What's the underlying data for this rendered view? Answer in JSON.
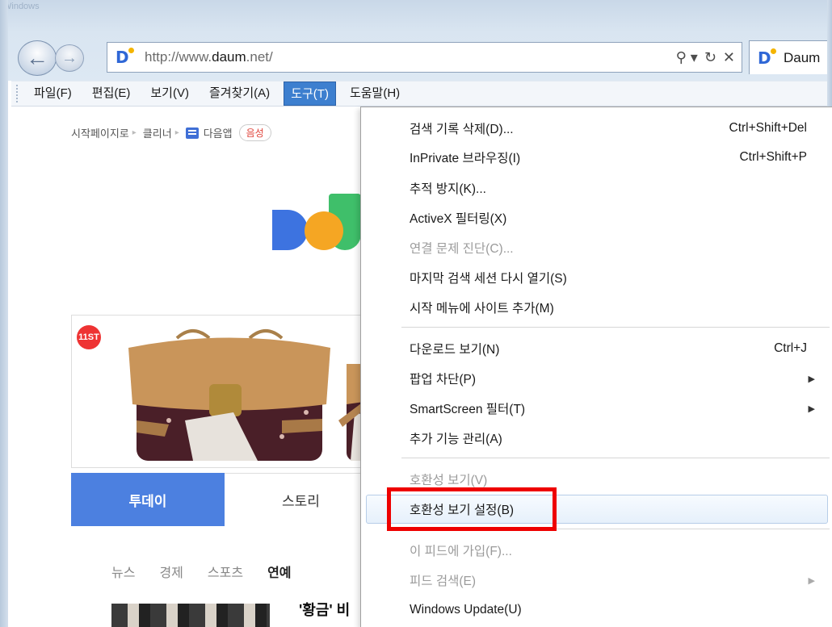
{
  "window": {
    "title_fragment": "Windows Internet Explorer"
  },
  "navigation": {
    "back_label": "←",
    "forward_label": "→"
  },
  "address_bar": {
    "url_prefix": "http://www.",
    "url_domain": "daum",
    "url_suffix": ".net/",
    "search_icon": "⚲ ▾",
    "refresh_icon": "↻",
    "stop_icon": "✕"
  },
  "tab": {
    "title": "Daum"
  },
  "menubar": {
    "items": [
      {
        "label": "파일(F)"
      },
      {
        "label": "편집(E)"
      },
      {
        "label": "보기(V)"
      },
      {
        "label": "즐겨찾기(A)"
      },
      {
        "label": "도구(T)",
        "active": true
      },
      {
        "label": "도움말(H)"
      }
    ]
  },
  "page": {
    "startbar": {
      "start_page": "시작페이지로",
      "cleaner": "클리너",
      "app": "다음앱",
      "pill": "음성"
    },
    "ad_badge": "11ST",
    "tabs": [
      {
        "label": "투데이",
        "active": true
      },
      {
        "label": "스토리",
        "active": false
      }
    ],
    "subnav": [
      "뉴스",
      "경제",
      "스포츠",
      "연예"
    ],
    "news_title": "'황금' 비"
  },
  "tools_menu": {
    "items": [
      {
        "label": "검색 기록 삭제(D)...",
        "shortcut": "Ctrl+Shift+Del",
        "enabled": true
      },
      {
        "label": "InPrivate 브라우징(I)",
        "shortcut": "Ctrl+Shift+P",
        "enabled": true
      },
      {
        "label": "추적 방지(K)...",
        "shortcut": "",
        "enabled": true
      },
      {
        "label": "ActiveX 필터링(X)",
        "shortcut": "",
        "enabled": true
      },
      {
        "label": "연결 문제 진단(C)...",
        "shortcut": "",
        "enabled": false
      },
      {
        "label": "마지막 검색 세션 다시 열기(S)",
        "shortcut": "",
        "enabled": true
      },
      {
        "label": "시작 메뉴에 사이트 추가(M)",
        "shortcut": "",
        "enabled": true
      },
      {
        "label": "다운로드 보기(N)",
        "shortcut": "Ctrl+J",
        "enabled": true
      },
      {
        "label": "팝업 차단(P)",
        "shortcut": "",
        "submenu": true,
        "enabled": true
      },
      {
        "label": "SmartScreen 필터(T)",
        "shortcut": "",
        "submenu": true,
        "enabled": true
      },
      {
        "label": "추가 기능 관리(A)",
        "shortcut": "",
        "enabled": true
      },
      {
        "label": "호환성 보기(V)",
        "shortcut": "",
        "enabled": false
      },
      {
        "label": "호환성 보기 설정(B)",
        "shortcut": "",
        "enabled": true,
        "highlighted": true
      },
      {
        "label": "이 피드에 가입(F)...",
        "shortcut": "",
        "enabled": false
      },
      {
        "label": "피드 검색(E)",
        "shortcut": "",
        "submenu": true,
        "enabled": false
      },
      {
        "label": "Windows Update(U)",
        "shortcut": "",
        "enabled": true
      }
    ],
    "submenu_arrow": "▶"
  },
  "colors": {
    "menu_active_bg": "#3d7fcf",
    "highlight_border": "#ee0000",
    "today_tab": "#4c80e0"
  }
}
